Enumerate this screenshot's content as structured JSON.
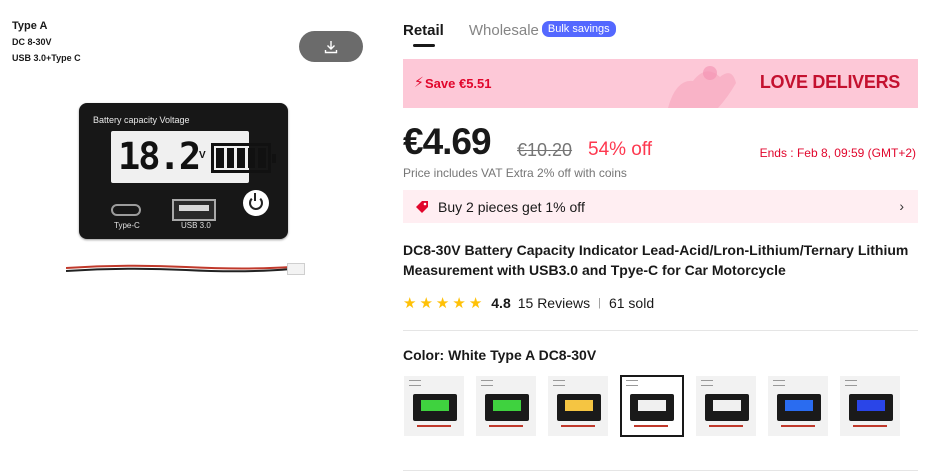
{
  "image": {
    "caption_line1": "Type A",
    "caption_line2": "DC 8-30V",
    "caption_line3": "USB 3.0+Type C",
    "device_title": "Battery capacity Voltage",
    "lcd_value": "18.2",
    "lcd_unit": "V",
    "port_c_label": "Type-C",
    "port_a_label": "USB 3.0",
    "download_icon": "download-icon"
  },
  "tabs": {
    "retail": "Retail",
    "wholesale": "Wholesale",
    "bulk_badge": "Bulk savings"
  },
  "promo": {
    "save_text": "Save €5.51",
    "brand_text": "LOVE DELIVERS",
    "icon": "flash-icon"
  },
  "price": {
    "current": "€4.69",
    "original": "€10.20",
    "discount": "54% off",
    "ends": "Ends :  Feb 8, 09:59 (GMT+2)",
    "vat_note": "Price includes VAT Extra 2% off with coins"
  },
  "coupon": {
    "text": "Buy 2 pieces get 1% off",
    "icon": "tag-icon"
  },
  "product": {
    "title": "DC8-30V Battery Capacity Indicator Lead-Acid/Lron-Lithium/Ternary Lithium Measurement with USB3.0 and Tpye-C for Car Motorcycle"
  },
  "rating": {
    "stars": 5,
    "score": "4.8",
    "reviews": "15 Reviews",
    "sold": "61 sold"
  },
  "color": {
    "label": "Color: White Type A DC8-30V",
    "selected_index": 3,
    "options": [
      {
        "lcd": "#3fd23f"
      },
      {
        "lcd": "#3fd23f"
      },
      {
        "lcd": "#f5c542"
      },
      {
        "lcd": "#f0f0f0"
      },
      {
        "lcd": "#f0f0f0"
      },
      {
        "lcd": "#2a6cf0"
      },
      {
        "lcd": "#2a45e8"
      }
    ]
  },
  "colors": {
    "accent_red": "#e1062c",
    "promo_bg": "#fdc8d7",
    "bulk_badge": "#5468ff",
    "star": "#ffc107"
  }
}
